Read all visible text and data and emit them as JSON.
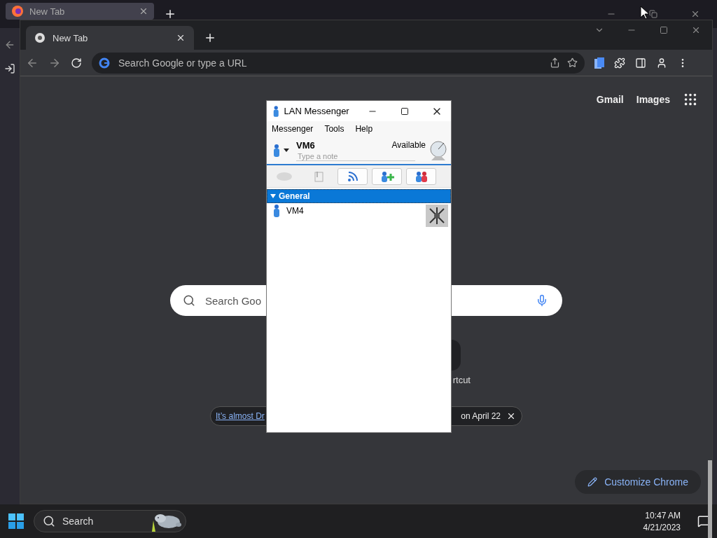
{
  "firefox": {
    "tab": {
      "title": "New Tab"
    }
  },
  "chrome": {
    "tab": {
      "title": "New Tab"
    },
    "omnibox": {
      "placeholder": "Search Google or type a URL"
    },
    "top_links": [
      "Gmail",
      "Images"
    ],
    "search": {
      "placeholder": "Search Goo"
    },
    "shortcut": {
      "label": "rtcut"
    },
    "promo": {
      "link": "It’s almost Dr",
      "text": "on April 22"
    },
    "customize": "Customize Chrome"
  },
  "lan_messenger": {
    "title": "LAN Messenger",
    "menu": [
      "Messenger",
      "Tools",
      "Help"
    ],
    "user": {
      "name": "VM6",
      "status": "Available",
      "note": {
        "placeholder": "Type a note"
      }
    },
    "toolbar": [
      {
        "kind": "chat",
        "disabled": true
      },
      {
        "kind": "file",
        "disabled": true
      },
      {
        "kind": "broadcast",
        "disabled": false
      },
      {
        "kind": "add",
        "disabled": false
      },
      {
        "kind": "group",
        "disabled": false
      }
    ],
    "groups": [
      {
        "name": "General",
        "expanded": true,
        "selected": true,
        "contacts": [
          {
            "name": "VM4"
          }
        ]
      }
    ]
  },
  "taskbar": {
    "search": "Search",
    "time": "10:47 AM",
    "date": "4/21/2023"
  }
}
